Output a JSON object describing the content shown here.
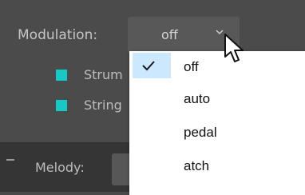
{
  "modulation": {
    "label": "Modulation:",
    "value": "off"
  },
  "options_rows": [
    {
      "label": "Strum"
    },
    {
      "label": "String"
    }
  ],
  "melody": {
    "label": "Melody:"
  },
  "dropdown": {
    "items": [
      {
        "label": "off",
        "selected": true
      },
      {
        "label": "auto",
        "selected": false
      },
      {
        "label": "pedal",
        "selected": false
      },
      {
        "label": "atch",
        "selected": false
      }
    ]
  },
  "colors": {
    "accent": "#16c9c4",
    "selection": "#cce8ff",
    "panel": "#4b4b4b"
  },
  "icons": {
    "check": "check-icon",
    "arrow": "chevron-down-icon",
    "cursor": "mouse-cursor-icon"
  }
}
